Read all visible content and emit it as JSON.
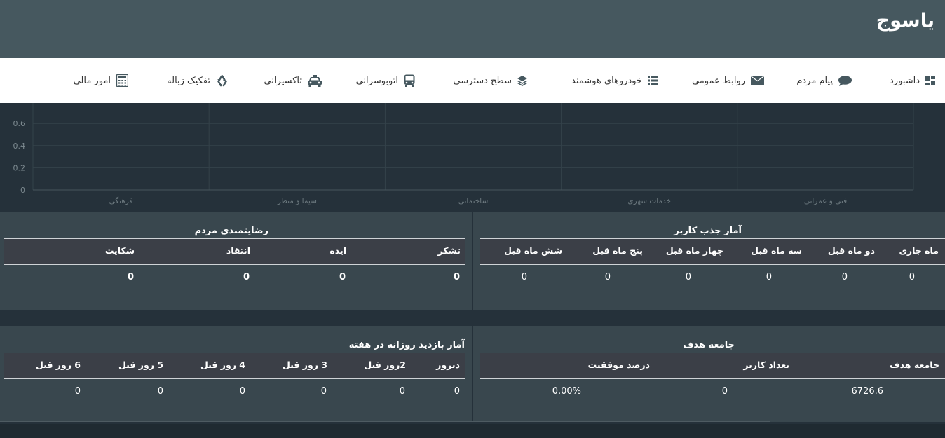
{
  "app": {
    "title": "یاسوج"
  },
  "nav": [
    {
      "label": "داشبورد",
      "icon": "dashboard-icon"
    },
    {
      "label": "پیام مردم",
      "icon": "comment-icon"
    },
    {
      "label": "روابط عمومی",
      "icon": "envelope-icon"
    },
    {
      "label": "خودروهای هوشمند",
      "icon": "list-icon"
    },
    {
      "label": "سطح دسترسی",
      "icon": "layers-icon"
    },
    {
      "label": "اتوبوسرانی",
      "icon": "bus-icon"
    },
    {
      "label": "تاکسیرانی",
      "icon": "taxi-icon"
    },
    {
      "label": "تفکیک زباله",
      "icon": "recycle-icon"
    },
    {
      "label": "امور مالی",
      "icon": "calculator-icon"
    }
  ],
  "chart_data": {
    "type": "bar",
    "categories": [
      "فرهنگی",
      "سیما و منظر",
      "ساختمانی",
      "خدمات شهری",
      "فنی و عمرانی"
    ],
    "values": [
      0,
      0,
      0,
      0,
      0
    ],
    "y_ticks": [
      "0.6",
      "0.4",
      "0.2",
      "0"
    ],
    "ylim": [
      0,
      0.8
    ],
    "grid": true
  },
  "user_stats": {
    "title": "آمار جذب کاربر",
    "headers": [
      "ماه جاری",
      "دو ماه قبل",
      "سه ماه قبل",
      "چهار ماه قبل",
      "پنج ماه قبل",
      "شش ماه قبل"
    ],
    "values": [
      "0",
      "0",
      "0",
      "0",
      "0",
      "0"
    ]
  },
  "satisfaction": {
    "title": "رضایتمندی مردم",
    "headers": [
      "تشکر",
      "ایده",
      "انتقاد",
      "شکایت"
    ],
    "values": [
      "0",
      "0",
      "0",
      "0"
    ]
  },
  "target": {
    "title": "جامعه هدف",
    "headers": [
      "جامعه هدف",
      "تعداد کاربر",
      "درصد موفقیت"
    ],
    "values": [
      "6726.6",
      "0",
      "0.00%"
    ]
  },
  "daily_visits": {
    "title": "آمار بازدید روزانه در هفته",
    "headers": [
      "دیروز",
      "2روز قبل",
      "3 روز قبل",
      "4 روز قبل",
      "5 روز قبل",
      "6 روز قبل"
    ],
    "values": [
      "0",
      "0",
      "0",
      "0",
      "0",
      "0"
    ]
  },
  "colors": {
    "topbar": "#46585f",
    "panel": "#39474e",
    "background": "#25313a"
  }
}
